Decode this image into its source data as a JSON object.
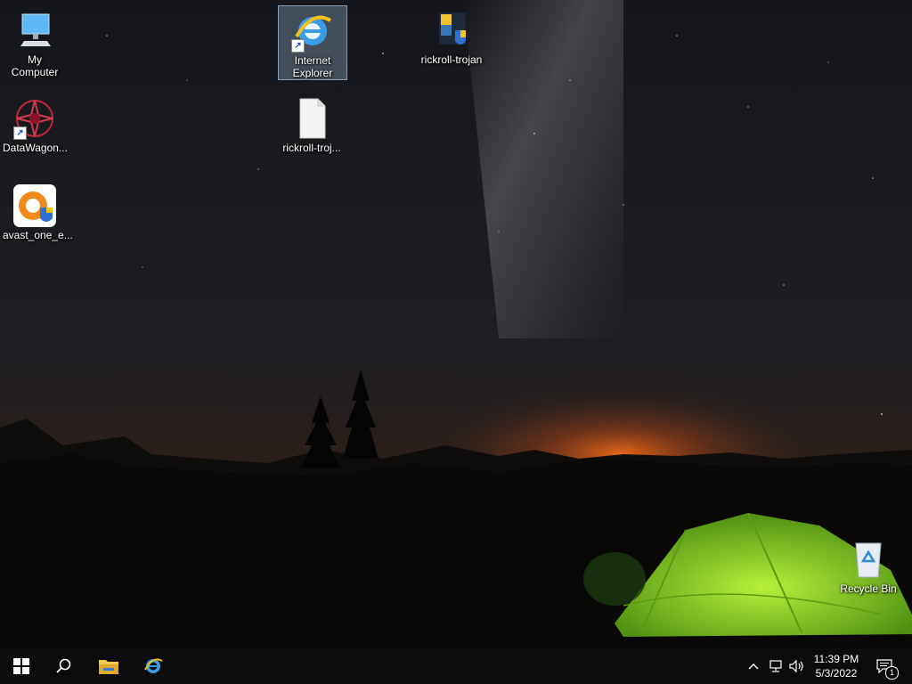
{
  "desktop": {
    "icons": {
      "my_computer": "My Computer",
      "internet_explorer": "Internet Explorer",
      "rickroll_trojan_exe": "rickroll-trojan",
      "datawagon": "DataWagon...",
      "rickroll_trojan_file": "rickroll-troj...",
      "avast": "avast_one_e...",
      "recycle_bin": "Recycle Bin"
    }
  },
  "taskbar": {
    "clock": {
      "time": "11:39 PM",
      "date": "5/3/2022"
    },
    "notifications_count": "1"
  },
  "colors": {
    "taskbar": "#0b0b0b",
    "sky": "#14161d",
    "tent": "#8fd12a",
    "horizon": "#e0621a"
  }
}
